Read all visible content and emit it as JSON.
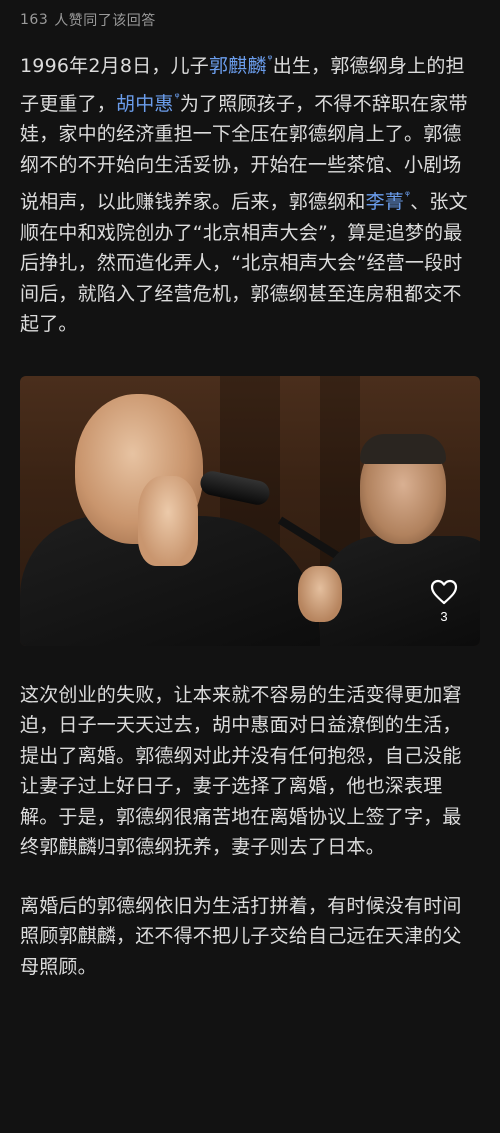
{
  "header": {
    "count": "163",
    "text": "人赞同了该回答"
  },
  "paragraph1": {
    "t1": "1996年2月8日，儿子",
    "link1": "郭麒麟",
    "t2": "出生，郭德纲身上的担子更重了，",
    "link2": "胡中惠",
    "t3": "为了照顾孩子，不得不辞职在家带娃，家中的经济重担一下全压在郭德纲肩上了。郭德纲不的不开始向生活妥协，开始在一些茶馆、小剧场说相声，以此赚钱养家。后来，郭德纲和",
    "link3": "李菁",
    "t4": "、张文顺在中和戏院创办了“北京相声大会”，算是追梦的最后挣扎，然而造化弄人，“北京相声大会”经营一段时间后，就陷入了经营危机，郭德纲甚至连房租都交不起了。",
    "search_mark": "ᵠ"
  },
  "image": {
    "like_icon": "heart-outline-icon",
    "like_count": "3"
  },
  "paragraph2": {
    "text": "这次创业的失败，让本来就不容易的生活变得更加窘迫，日子一天天过去，胡中惠面对日益潦倒的生活，提出了离婚。郭德纲对此并没有任何抱怨，自己没能让妻子过上好日子，妻子选择了离婚，他也深表理解。于是，郭德纲很痛苦地在离婚协议上签了字，最终郭麒麟归郭德纲抚养，妻子则去了日本。"
  },
  "paragraph3": {
    "text": "离婚后的郭德纲依旧为生活打拼着，有时候没有时间照顾郭麒麟，还不得不把儿子交给自己远在天津的父母照顾。"
  },
  "colors": {
    "background": "#121212",
    "text": "#dcdcdc",
    "link": "#6b9dec",
    "muted": "#9a9a9a"
  }
}
